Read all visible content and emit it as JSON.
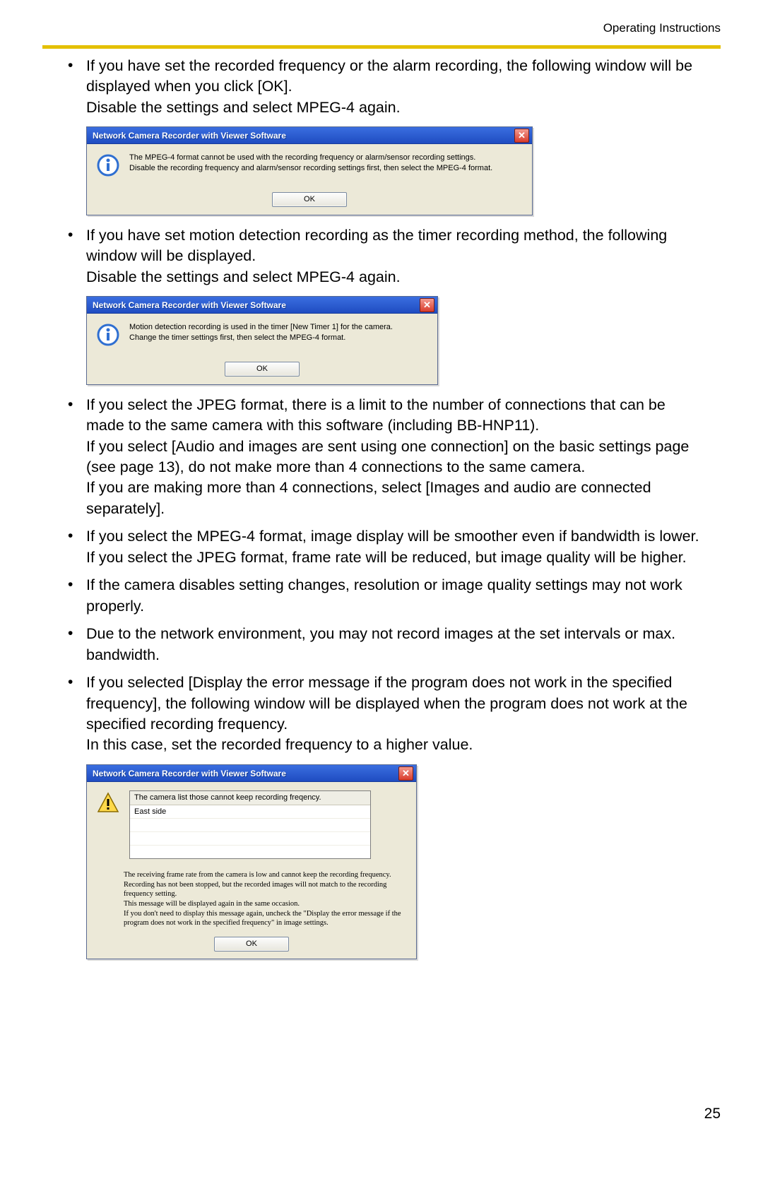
{
  "header": {
    "running": "Operating Instructions"
  },
  "page_number": "25",
  "dialogs": {
    "title": "Network Camera Recorder with Viewer Software",
    "ok": "OK",
    "d1_l1": "The MPEG-4 format cannot be used with the recording frequency or alarm/sensor recording settings.",
    "d1_l2": "Disable the recording frequency and alarm/sensor recording settings first, then select the MPEG-4 format.",
    "d2_l1": "Motion detection recording is used in the timer [New Timer 1] for the camera.",
    "d2_l2": "Change the timer settings first, then select the MPEG-4 format.",
    "d3_hdr": "The camera list those cannot keep recording freqency.",
    "d3_row": "East side",
    "d3_note1": "The receiving frame rate from the camera is low and cannot keep the recording frequency.",
    "d3_note2": "Recording has not been stopped, but the recorded images will not match to the recording frequency setting.",
    "d3_note3": "This message will be displayed again in the same occasion.",
    "d3_note4": "If you don't need to display this message again, uncheck the \"Display the error message if the program does not work in the specified frequency\" in image settings."
  },
  "bullets": {
    "b1a": "If you have set the recorded frequency or the alarm recording, the following window will be displayed when you click [OK].",
    "b1b": "Disable the settings and select MPEG-4 again.",
    "b2a": "If you have set motion detection recording as the timer recording method, the following window will be displayed.",
    "b2b": "Disable the settings and select MPEG-4 again.",
    "b3a": "If you select the JPEG format, there is a limit to the number of connections that can be made to the same camera with this software (including BB-HNP11).",
    "b3b": "If you select [Audio and images are sent using one connection] on the basic settings page (see page 13), do not make more than 4 connections to the same camera.",
    "b3c": "If you are making more than 4 connections, select [Images and audio are connected separately].",
    "b4a": "If you select the MPEG-4 format, image display will be smoother even if bandwidth is lower.",
    "b4b": "If you select the JPEG format, frame rate will be reduced, but image quality will be higher.",
    "b5": "If the camera disables setting changes, resolution or image quality settings may not work properly.",
    "b6": "Due to the network environment, you may not record images at the set intervals or max. bandwidth.",
    "b7a": "If you selected [Display the error message if the program does not work in the specified frequency], the following window will be displayed when the program does not work at the specified recording frequency.",
    "b7b": "In this case, set the recorded frequency to a higher value."
  }
}
